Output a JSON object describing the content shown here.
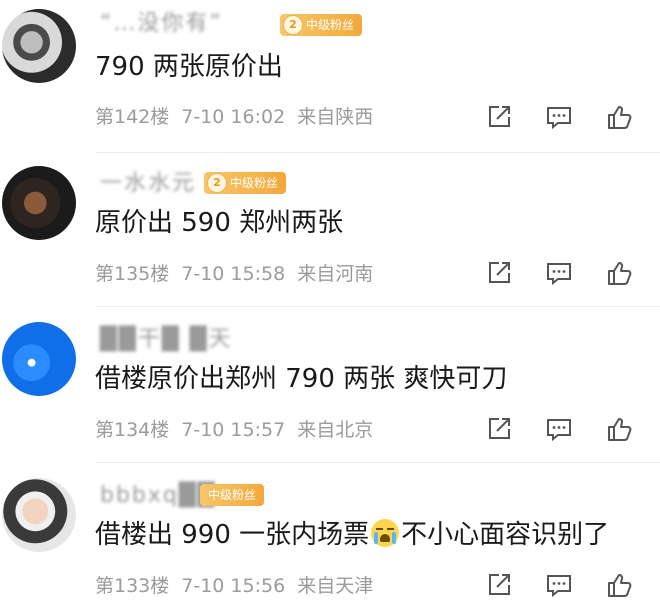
{
  "comments": [
    {
      "username": "“…没你有”",
      "badge_level": "2",
      "badge": "中级粉丝",
      "text": "790 两张原价出",
      "floor": "第142楼",
      "time": "7-10 16:02",
      "location": "来自陕西"
    },
    {
      "username": "一水水元",
      "badge_level": "2",
      "badge": "中级粉丝",
      "text": "原价出 590 郑州两张",
      "floor": "第135楼",
      "time": "7-10 15:58",
      "location": "来自河南"
    },
    {
      "username": "██干█  █天",
      "text": "借楼原价出郑州 790 两张  爽快可刀",
      "floor": "第134楼",
      "time": "7-10 15:57",
      "location": "来自北京"
    },
    {
      "username": "bbbxq██",
      "badge": "中级粉丝",
      "text_before": "借楼出 990 一张内场票",
      "text_after": "不小心面容识别了",
      "emoji": "crying-face-icon",
      "floor": "第133楼",
      "time": "7-10 15:56",
      "location": "来自天津"
    }
  ],
  "actions": {
    "share_icon": "share-icon",
    "reply_icon": "comment-icon",
    "like_icon": "thumbs-up-icon"
  },
  "colors": {
    "badge": "#f4a83a",
    "meta_text": "#9b9b9b",
    "body_text": "#1a1a1a"
  }
}
